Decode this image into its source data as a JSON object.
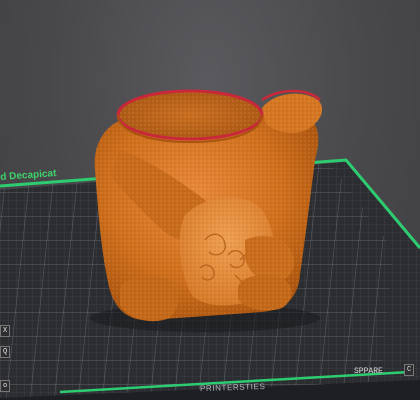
{
  "app": {
    "view": "3d-preview",
    "colors": {
      "background": "#4a4a4d",
      "bed_plate": "#2c2d31",
      "bed_grid": "#6b6f78",
      "bed_border": "#2ecc71",
      "model_fill": "#d2741e",
      "model_rim": "#c8283a"
    }
  },
  "bed": {
    "brand_left": "d Decapicat",
    "brand_front": "PRINTERSTIES",
    "corner_left_1": "X",
    "corner_left_2": "Q",
    "corner_left_3": "o",
    "corner_right_1": "SPPARE",
    "corner_right_2": "C"
  },
  "model": {
    "name": "bear-shaped-pot",
    "icon": "3d-model"
  }
}
